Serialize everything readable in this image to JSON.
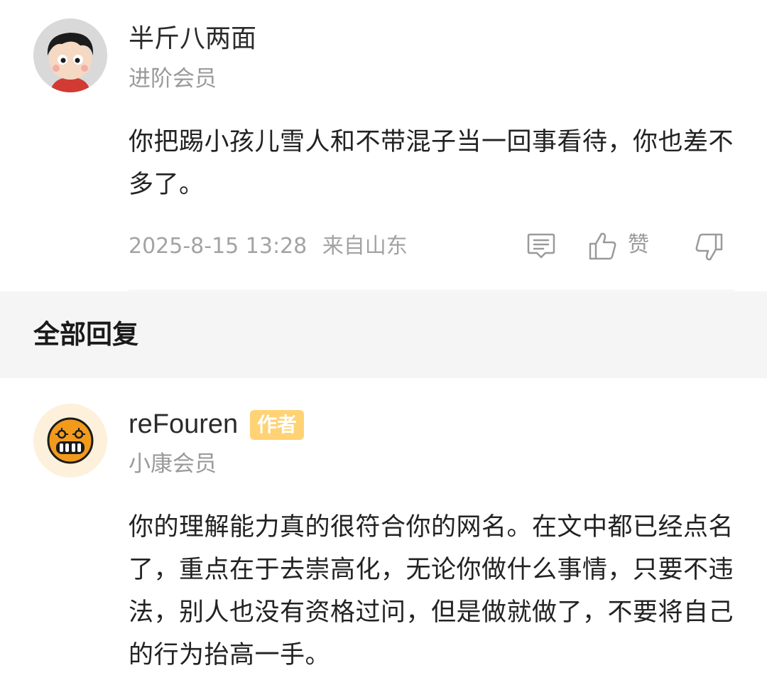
{
  "top_comment": {
    "username": "半斤八两面",
    "level": "进阶会员",
    "text": "你把踢小孩儿雪人和不带混子当一回事看待，你也差不多了。",
    "timestamp": "2025-8-15 13:28",
    "location": "来自山东",
    "like_label": "赞",
    "icons": [
      "comment-icon",
      "thumbs-up-icon",
      "thumbs-down-icon"
    ]
  },
  "section": {
    "title": "全部回复"
  },
  "reply": {
    "username": "reFouren",
    "badge": "作者",
    "level": "小康会员",
    "text": "你的理解能力真的很符合你的网名。在文中都已经点名了，重点在于去崇高化，无论你做什么事情，只要不违法，别人也没有资格过问，但是做就做了，不要将自己的行为抬高一手。"
  },
  "colors": {
    "badge_bg": "#ffd274",
    "secondary_text": "#9a9a9a",
    "section_bg": "#f5f5f5"
  }
}
